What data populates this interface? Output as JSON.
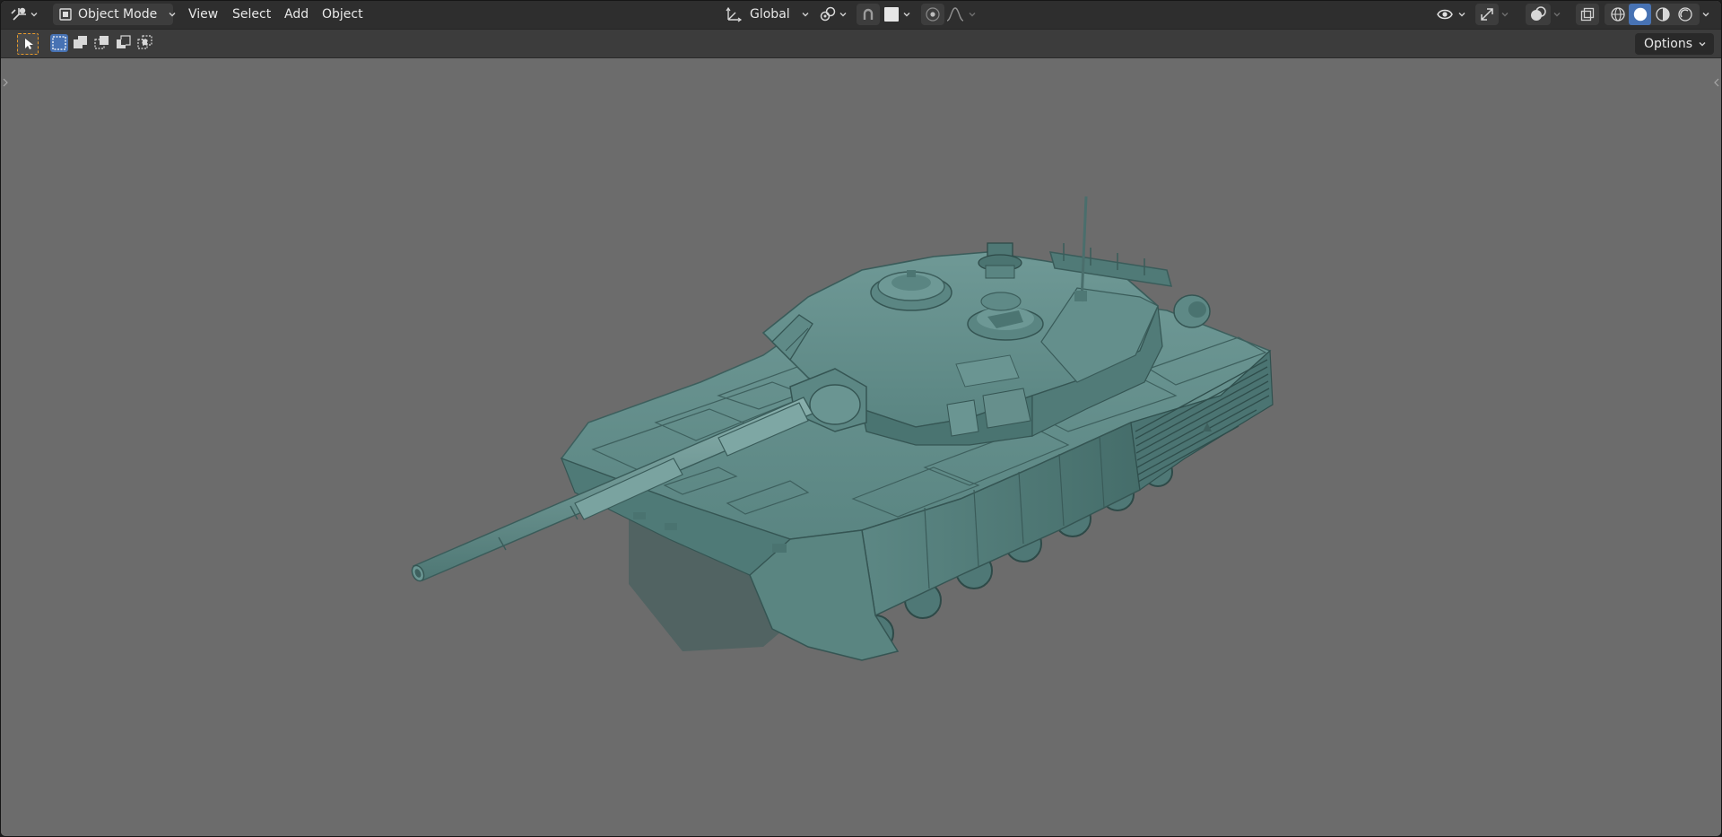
{
  "header": {
    "editor_type_icon": "viewport-editor-icon",
    "mode": {
      "label": "Object Mode",
      "icon": "object-mode-icon"
    },
    "menus": [
      "View",
      "Select",
      "Add",
      "Object"
    ],
    "transform_orientation": {
      "label": "Global",
      "icon": "orientation-icon"
    },
    "snapping_icon": "snap-icon",
    "proportional_icon": "proportional-editing-icon",
    "falloff_icon": "falloff-curve-icon"
  },
  "tool_header": {
    "active_tool_icon": "select-box-tool-icon",
    "select_modes": [
      "mode-set-icon",
      "mode-extend-icon",
      "mode-subtract-icon",
      "mode-intersect-icon"
    ],
    "options_label": "Options"
  },
  "viewport": {
    "background_color": "#6c6c6c",
    "model_color": "#5f8a87",
    "object": "tank-model"
  },
  "shading": {
    "modes": [
      "wireframe",
      "solid",
      "material-preview",
      "rendered"
    ],
    "active": "solid"
  },
  "colors": {
    "header_bg": "#2e2e2e",
    "toolbar_bg": "#3c3c3c",
    "accent_blue": "#4772b3",
    "active_tool_orange": "#e89b2b"
  }
}
